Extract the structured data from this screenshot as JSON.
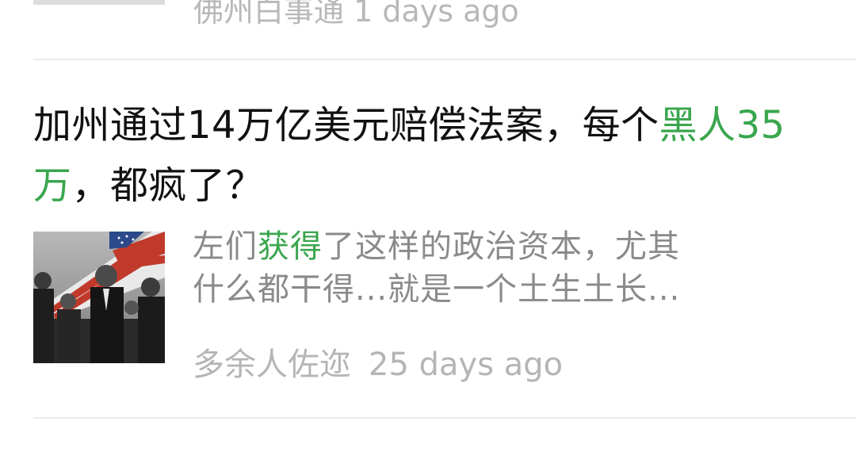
{
  "previous_item": {
    "source": "佛州白事通",
    "time": "1 days ago"
  },
  "article": {
    "title_pre": "加州通过14万亿美元赔偿法案，每个",
    "title_highlight": "黑人35万",
    "title_post": "，都疯了？",
    "summary_line1_pre": "左们",
    "summary_highlight": "获得",
    "summary_line1_post": "了这样的政治资本，尤其",
    "summary_line2": "什么都干得...就是一个土生土长...",
    "source": "多余人佐迩",
    "time": "25 days ago",
    "thumbnail_icon": "protest-photo-with-flag",
    "highlight_color": "#3aa64e"
  }
}
